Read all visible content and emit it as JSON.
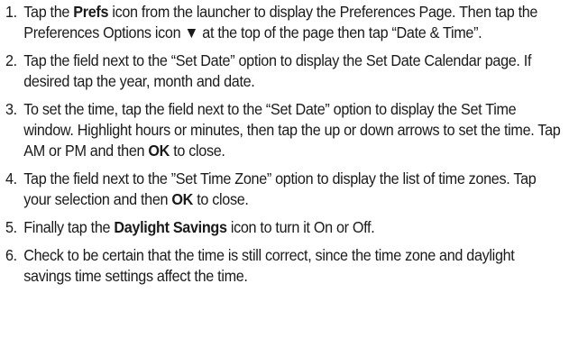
{
  "steps": [
    {
      "number": "1.",
      "parts": [
        {
          "text": "Tap the "
        },
        {
          "text": "Prefs",
          "bold": true
        },
        {
          "text": " icon from the launcher to display the Preferences Page. Then tap the Preferences Options icon ▼ at the top of the page then tap “Date & Time”."
        }
      ]
    },
    {
      "number": "2.",
      "parts": [
        {
          "text": "Tap the field next to the “Set Date” option to display the Set Date Calendar page. If desired tap the year, month and date."
        }
      ]
    },
    {
      "number": "3.",
      "parts": [
        {
          "text": "To set the time, tap the field next to the “Set Date” option to display the Set Time window.  Highlight hours or minutes, then tap the up or down arrows to set the time. Tap AM or PM and then "
        },
        {
          "text": "OK",
          "bold": true
        },
        {
          "text": " to close."
        }
      ]
    },
    {
      "number": "4.",
      "parts": [
        {
          "text": "Tap the field next to the ”Set Time Zone” option to display the list of time zones. Tap your selection and then "
        },
        {
          "text": "OK",
          "bold": true
        },
        {
          "text": " to close."
        }
      ]
    },
    {
      "number": "5.",
      "parts": [
        {
          "text": "Finally tap the "
        },
        {
          "text": "Daylight Savings",
          "bold": true
        },
        {
          "text": " icon to turn it On or Off."
        }
      ]
    },
    {
      "number": "6.",
      "parts": [
        {
          "text": "Check to be certain that the time is still correct, since the time zone and daylight savings time settings affect the time."
        }
      ]
    }
  ]
}
